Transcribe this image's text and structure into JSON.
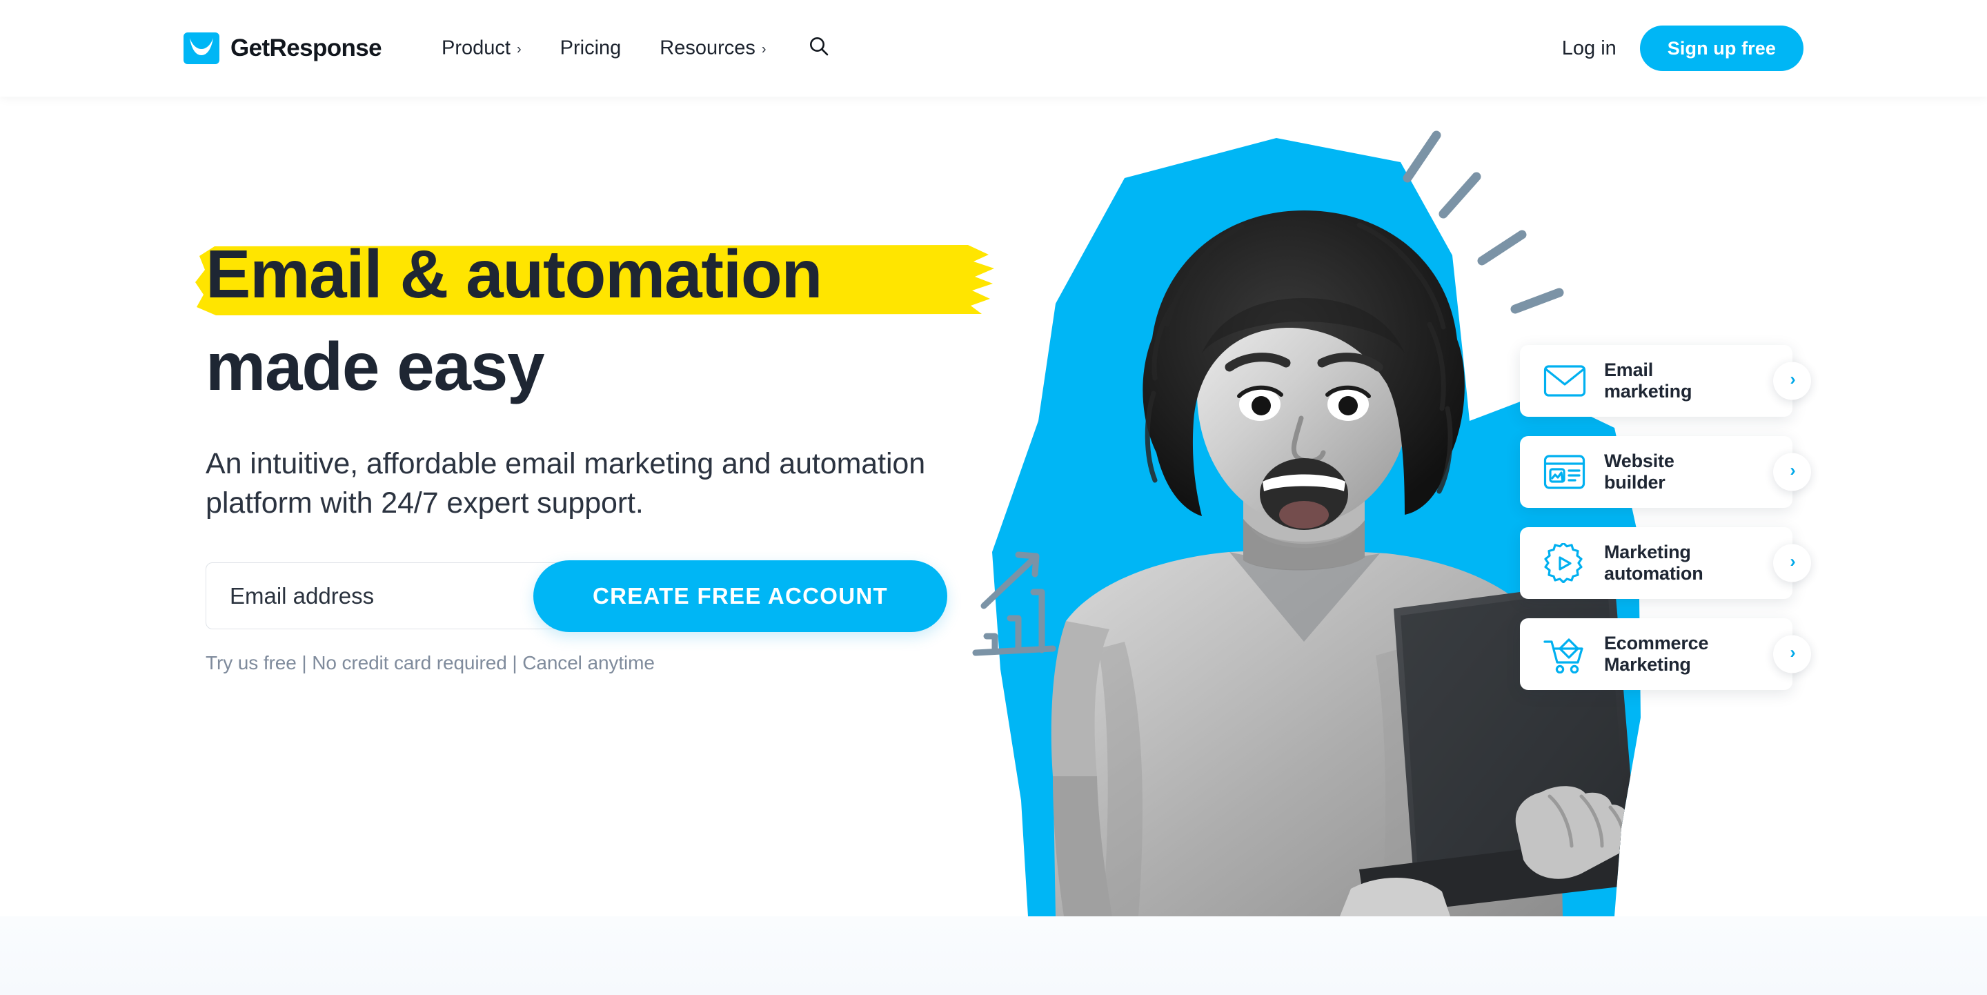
{
  "header": {
    "brand": {
      "name": "GetResponse",
      "logo_icon": "envelope-smile-logo",
      "logo_color": "#00b6f5"
    },
    "nav": [
      {
        "label": "Product",
        "caret": "›",
        "has_dropdown": true
      },
      {
        "label": "Pricing",
        "caret": "",
        "has_dropdown": false
      },
      {
        "label": "Resources",
        "caret": "›",
        "has_dropdown": true
      }
    ],
    "search_icon": "search-icon",
    "login_label": "Log in",
    "signup_label": "Sign up free"
  },
  "hero": {
    "headline_line1": "Email & automation",
    "headline_line2": "made easy",
    "highlight_color": "#ffe500",
    "subheadline": "An intuitive, affordable email marketing and automation platform with 24/7 expert support.",
    "form": {
      "email_placeholder": "Email address",
      "email_value": "",
      "cta_label": "CREATE FREE ACCOUNT",
      "note": "Try us free | No credit card required | Cancel anytime"
    },
    "art": {
      "blob_color": "#00b6f5",
      "doodle_color": "#7b93a6",
      "chart_doodle_icon": "growth-chart-doodle-icon",
      "rays_icon": "excitement-rays-icon",
      "photo_alt": "excited-woman-holding-laptop"
    }
  },
  "cards": [
    {
      "label_line1": "Email",
      "label_line2": "marketing",
      "icon": "envelope-icon",
      "arrow": "›"
    },
    {
      "label_line1": "Website",
      "label_line2": "builder",
      "icon": "website-builder-icon",
      "arrow": "›"
    },
    {
      "label_line1": "Marketing",
      "label_line2": "automation",
      "icon": "gear-play-icon",
      "arrow": "›"
    },
    {
      "label_line1": "Ecommerce",
      "label_line2": "Marketing",
      "icon": "shopping-cart-icon",
      "arrow": "›"
    }
  ],
  "colors": {
    "brand_cyan": "#00b6f5",
    "ink": "#1e2633",
    "muted": "#7f8b9c",
    "highlight_yellow": "#ffe500"
  }
}
